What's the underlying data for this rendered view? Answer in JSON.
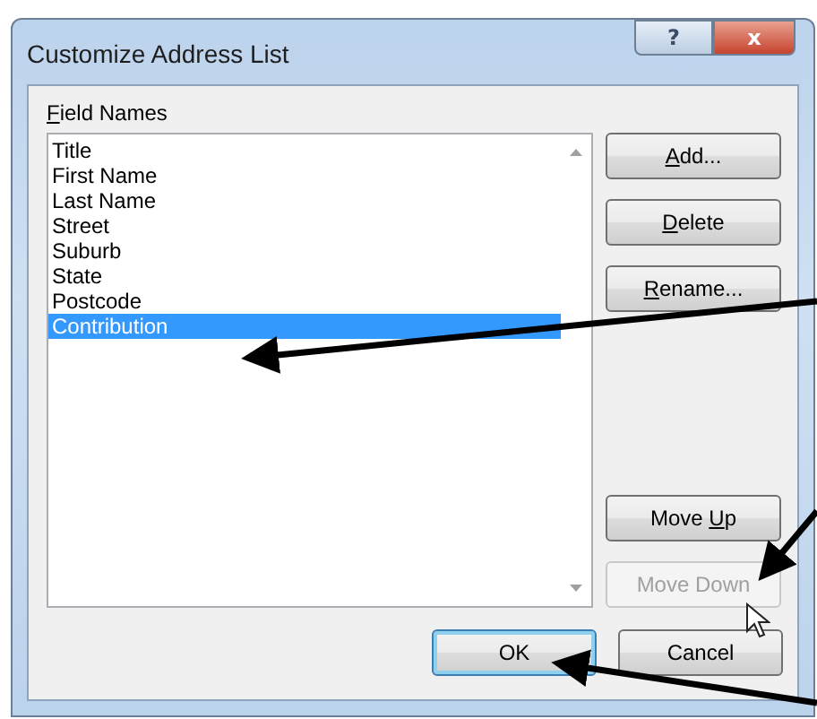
{
  "window": {
    "title": "Customize Address List",
    "help_button": "?",
    "close_button": "x"
  },
  "field_names": {
    "label": {
      "key": "F",
      "rest": "ield Names"
    },
    "items": [
      {
        "label": "Title",
        "selected": false
      },
      {
        "label": "First Name",
        "selected": false
      },
      {
        "label": "Last Name",
        "selected": false
      },
      {
        "label": "Street",
        "selected": false
      },
      {
        "label": "Suburb",
        "selected": false
      },
      {
        "label": "State",
        "selected": false
      },
      {
        "label": "Postcode",
        "selected": false
      },
      {
        "label": "Contribution",
        "selected": true
      }
    ]
  },
  "side_buttons": [
    {
      "key": "A",
      "after": "dd...",
      "disabled": false
    },
    {
      "key": "D",
      "after": "elete",
      "disabled": false
    },
    {
      "key": "R",
      "after": "ename...",
      "disabled": false
    },
    {
      "before": "Move ",
      "key": "U",
      "after": "p",
      "disabled": false
    },
    {
      "before": "Move Down",
      "disabled": true
    }
  ],
  "footer_buttons": [
    {
      "label": "OK",
      "default": true
    },
    {
      "label": "Cancel",
      "default": false
    }
  ]
}
